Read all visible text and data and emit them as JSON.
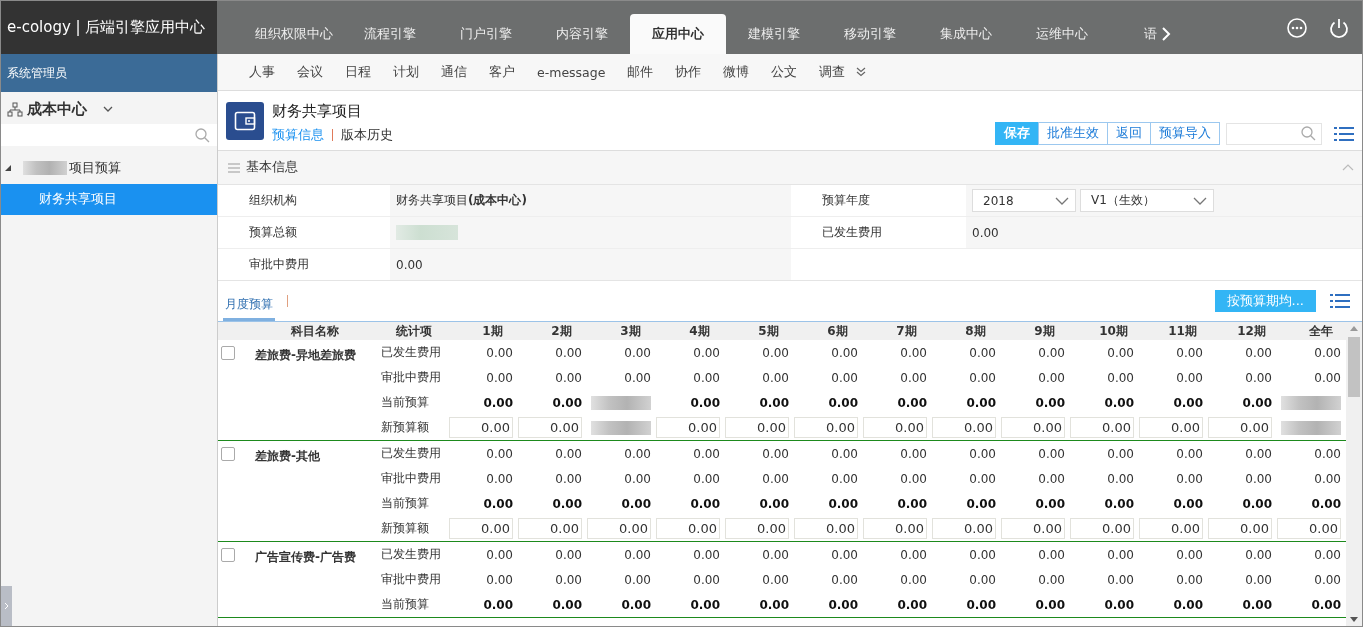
{
  "app": {
    "logo_text": "e-cology | 后端引擎应用中心",
    "user": "系统管理员"
  },
  "top_tabs": [
    {
      "label": "组织权限中心",
      "selected": false
    },
    {
      "label": "流程引擎",
      "selected": false
    },
    {
      "label": "门户引擎",
      "selected": false
    },
    {
      "label": "内容引擎",
      "selected": false
    },
    {
      "label": "应用中心",
      "selected": true
    },
    {
      "label": "建模引擎",
      "selected": false
    },
    {
      "label": "移动引擎",
      "selected": false
    },
    {
      "label": "集成中心",
      "selected": false
    },
    {
      "label": "运维中心",
      "selected": false
    },
    {
      "label": "语",
      "selected": false
    }
  ],
  "sub_nav": [
    "人事",
    "会议",
    "日程",
    "计划",
    "通信",
    "客户",
    "e-message",
    "邮件",
    "协作",
    "微博",
    "公文",
    "调查"
  ],
  "sidebar": {
    "title": "成本中心",
    "tree": [
      {
        "label": "项目预算",
        "redacted_prefix": true,
        "expanded": true,
        "selected": false,
        "children": [
          {
            "label": "财务共享项目",
            "selected": true
          }
        ]
      }
    ]
  },
  "header": {
    "title": "财务共享项目",
    "links": [
      {
        "label": "预算信息",
        "selected": true
      },
      {
        "label": "版本历史",
        "selected": false
      }
    ],
    "buttons": [
      {
        "label": "保存",
        "primary": true
      },
      {
        "label": "批准生效",
        "primary": false
      },
      {
        "label": "返回",
        "primary": false
      },
      {
        "label": "预算导入",
        "primary": false
      }
    ]
  },
  "basic_info": {
    "title": "基本信息",
    "fields": [
      {
        "label": "组织机构",
        "value": "财务共享项目**(成本中心)**",
        "kind": "text"
      },
      {
        "label": "预算年度",
        "kind": "selects",
        "selects": [
          "2018",
          "V1（生效）"
        ]
      },
      {
        "label": "预算总额",
        "kind": "redacted"
      },
      {
        "label": "已发生费用",
        "value": "0.00",
        "kind": "text"
      },
      {
        "label": "审批中费用",
        "value": "0.00",
        "kind": "text"
      }
    ]
  },
  "budget_tabs": [
    {
      "label": "月度预算",
      "selected": true
    }
  ],
  "average_button": "按预算期均...",
  "table": {
    "columns": [
      "科目名称",
      "统计项",
      "1期",
      "2期",
      "3期",
      "4期",
      "5期",
      "6期",
      "7期",
      "8期",
      "9期",
      "10期",
      "11期",
      "12期",
      "全年"
    ],
    "groups": [
      {
        "name": "差旅费-异地差旅费",
        "checked": false,
        "rows": [
          {
            "item": "已发生费用",
            "kind": "plain",
            "values": [
              "0.00",
              "0.00",
              "0.00",
              "0.00",
              "0.00",
              "0.00",
              "0.00",
              "0.00",
              "0.00",
              "0.00",
              "0.00",
              "0.00",
              "0.00"
            ]
          },
          {
            "item": "审批中费用",
            "kind": "plain",
            "values": [
              "0.00",
              "0.00",
              "0.00",
              "0.00",
              "0.00",
              "0.00",
              "0.00",
              "0.00",
              "0.00",
              "0.00",
              "0.00",
              "0.00",
              "0.00"
            ]
          },
          {
            "item": "当前预算",
            "kind": "bold",
            "values": [
              "0.00",
              "0.00",
              {
                "redacted": true
              },
              "0.00",
              "0.00",
              "0.00",
              "0.00",
              "0.00",
              "0.00",
              "0.00",
              "0.00",
              "0.00",
              {
                "redacted": true
              }
            ]
          },
          {
            "item": "新预算额",
            "kind": "input",
            "values": [
              "0.00",
              "0.00",
              {
                "redacted": true
              },
              "0.00",
              "0.00",
              "0.00",
              "0.00",
              "0.00",
              "0.00",
              "0.00",
              "0.00",
              "0.00",
              {
                "redacted": true
              }
            ]
          }
        ]
      },
      {
        "name": "差旅费-其他",
        "checked": false,
        "rows": [
          {
            "item": "已发生费用",
            "kind": "plain",
            "values": [
              "0.00",
              "0.00",
              "0.00",
              "0.00",
              "0.00",
              "0.00",
              "0.00",
              "0.00",
              "0.00",
              "0.00",
              "0.00",
              "0.00",
              "0.00"
            ]
          },
          {
            "item": "审批中费用",
            "kind": "plain",
            "values": [
              "0.00",
              "0.00",
              "0.00",
              "0.00",
              "0.00",
              "0.00",
              "0.00",
              "0.00",
              "0.00",
              "0.00",
              "0.00",
              "0.00",
              "0.00"
            ]
          },
          {
            "item": "当前预算",
            "kind": "bold",
            "values": [
              "0.00",
              "0.00",
              "0.00",
              "0.00",
              "0.00",
              "0.00",
              "0.00",
              "0.00",
              "0.00",
              "0.00",
              "0.00",
              "0.00",
              "0.00"
            ]
          },
          {
            "item": "新预算额",
            "kind": "input",
            "values": [
              "0.00",
              "0.00",
              "0.00",
              "0.00",
              "0.00",
              "0.00",
              "0.00",
              "0.00",
              "0.00",
              "0.00",
              "0.00",
              "0.00",
              "0.00"
            ]
          }
        ]
      },
      {
        "name": "广告宣传费-广告费",
        "checked": false,
        "rows": [
          {
            "item": "已发生费用",
            "kind": "plain",
            "values": [
              "0.00",
              "0.00",
              "0.00",
              "0.00",
              "0.00",
              "0.00",
              "0.00",
              "0.00",
              "0.00",
              "0.00",
              "0.00",
              "0.00",
              "0.00"
            ]
          },
          {
            "item": "审批中费用",
            "kind": "plain",
            "values": [
              "0.00",
              "0.00",
              "0.00",
              "0.00",
              "0.00",
              "0.00",
              "0.00",
              "0.00",
              "0.00",
              "0.00",
              "0.00",
              "0.00",
              "0.00"
            ]
          },
          {
            "item": "当前预算",
            "kind": "bold",
            "values": [
              "0.00",
              "0.00",
              "0.00",
              "0.00",
              "0.00",
              "0.00",
              "0.00",
              "0.00",
              "0.00",
              "0.00",
              "0.00",
              "0.00",
              "0.00"
            ]
          }
        ]
      }
    ]
  }
}
